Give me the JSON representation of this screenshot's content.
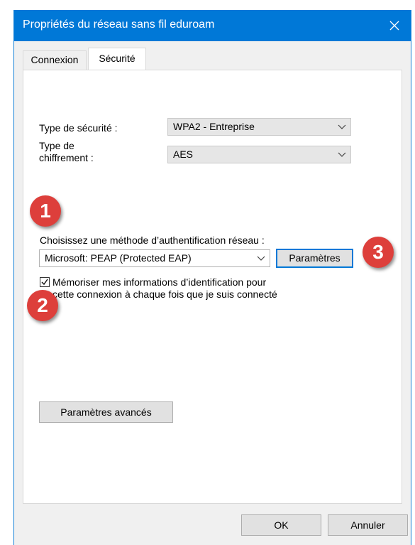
{
  "window": {
    "title": "Propriétés du réseau sans fil eduroam"
  },
  "tabs": [
    {
      "label": "Connexion",
      "active": false
    },
    {
      "label": "Sécurité",
      "active": true
    }
  ],
  "security_type": {
    "label": "Type de sécurité :",
    "value": "WPA2 - Entreprise"
  },
  "encryption_type": {
    "label_line1": "Type de",
    "label_line2": "chiffrement :",
    "value": "AES"
  },
  "auth_method": {
    "label": "Choisissez une méthode d’authentification réseau :",
    "value": "Microsoft: PEAP (Protected EAP)"
  },
  "settings_button": {
    "label": "Paramètres"
  },
  "remember_checkbox": {
    "checked": true,
    "label_line1": "Mémoriser mes informations d’identification pour",
    "label_line2": "cette connexion à chaque fois que je suis connecté"
  },
  "advanced_button": {
    "label": "Paramètres avancés"
  },
  "footer": {
    "ok_label": "OK",
    "cancel_label": "Annuler"
  },
  "badges": [
    "1",
    "2",
    "3"
  ],
  "colors": {
    "titlebar": "#0078d7",
    "badge": "#dd3f3b",
    "focus_border": "#0078d7"
  },
  "icons": {
    "close": "close-icon",
    "dropdown": "chevron-down-icon",
    "check": "checkmark-icon"
  }
}
